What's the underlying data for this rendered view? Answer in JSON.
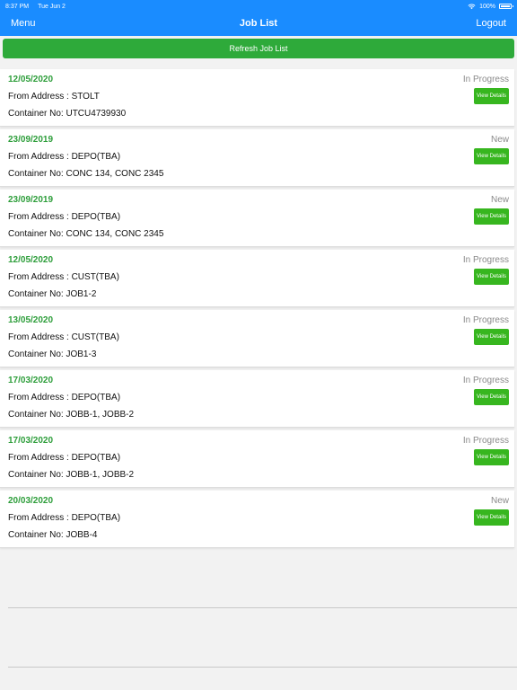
{
  "status_bar": {
    "time": "8:37 PM",
    "date": "Tue Jun 2",
    "battery": "100%"
  },
  "nav": {
    "menu_label": "Menu",
    "title": "Job List",
    "logout_label": "Logout"
  },
  "refresh_label": "Refresh Job List",
  "view_details_label": "View Details",
  "jobs": [
    {
      "date": "12/05/2020",
      "status": "In Progress",
      "from": "From Address : STOLT",
      "container": "Container No: UTCU4739930"
    },
    {
      "date": "23/09/2019",
      "status": "New",
      "from": "From Address : DEPO(TBA)",
      "container": "Container No: CONC 134, CONC 2345"
    },
    {
      "date": "23/09/2019",
      "status": "New",
      "from": "From Address : DEPO(TBA)",
      "container": "Container No: CONC 134, CONC 2345"
    },
    {
      "date": "12/05/2020",
      "status": "In Progress",
      "from": "From Address : CUST(TBA)",
      "container": "Container No: JOB1-2"
    },
    {
      "date": "13/05/2020",
      "status": "In Progress",
      "from": "From Address : CUST(TBA)",
      "container": "Container No: JOB1-3"
    },
    {
      "date": "17/03/2020",
      "status": "In Progress",
      "from": "From Address : DEPO(TBA)",
      "container": "Container No: JOBB-1, JOBB-2"
    },
    {
      "date": "17/03/2020",
      "status": "In Progress",
      "from": "From Address : DEPO(TBA)",
      "container": "Container No: JOBB-1, JOBB-2"
    },
    {
      "date": "20/03/2020",
      "status": "New",
      "from": "From Address : DEPO(TBA)",
      "container": "Container No: JOBB-4"
    }
  ]
}
